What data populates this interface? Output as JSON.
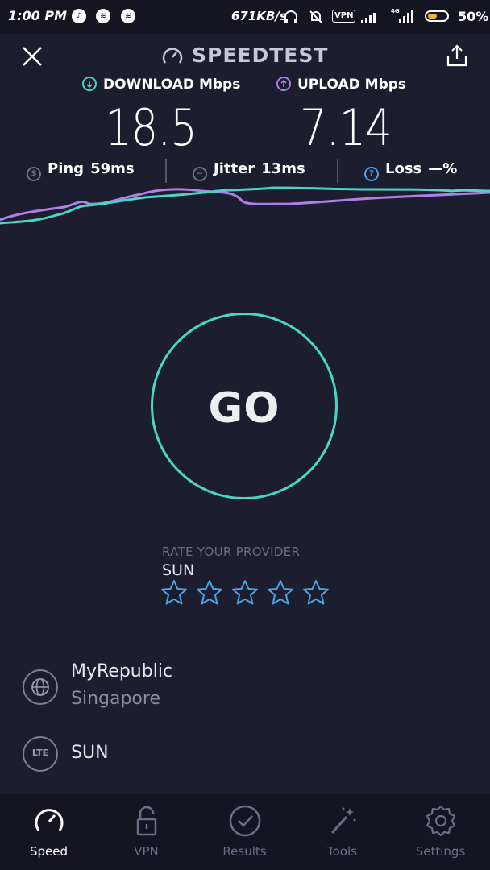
{
  "status_bar": {
    "time": "1:00 PM",
    "network_speed": "671KB/s",
    "vpn_label": "VPN",
    "battery_percent": "50%",
    "battery_level": 0.5
  },
  "header": {
    "title": "SPEEDTEST"
  },
  "results": {
    "download_label": "DOWNLOAD Mbps",
    "download_value": "18.5",
    "upload_label": "UPLOAD Mbps",
    "upload_value": "7.14",
    "ping_label": "Ping",
    "ping_value": "59ms",
    "jitter_label": "Jitter",
    "jitter_value": "13ms",
    "loss_label": "Loss",
    "loss_value": "—%"
  },
  "colors": {
    "download": "#48d7c6",
    "upload": "#b07ee8",
    "background": "#1c1d2e",
    "nav_background": "#141521",
    "star": "#4aa6e8"
  },
  "go_button": {
    "label": "GO"
  },
  "rating": {
    "title": "RATE YOUR PROVIDER",
    "provider": "SUN",
    "stars_total": 5,
    "stars_selected": 0
  },
  "connections": [
    {
      "icon": "globe-icon",
      "name": "MyRepublic",
      "location": "Singapore"
    },
    {
      "icon": "lte-icon",
      "badge": "LTE",
      "name": "SUN"
    }
  ],
  "nav": {
    "items": [
      {
        "label": "Speed",
        "icon": "gauge-icon",
        "active": true
      },
      {
        "label": "VPN",
        "icon": "lock-icon",
        "active": false
      },
      {
        "label": "Results",
        "icon": "check-circle-icon",
        "active": false
      },
      {
        "label": "Tools",
        "icon": "magic-wand-icon",
        "active": false
      },
      {
        "label": "Settings",
        "icon": "gear-icon",
        "active": false
      }
    ]
  }
}
